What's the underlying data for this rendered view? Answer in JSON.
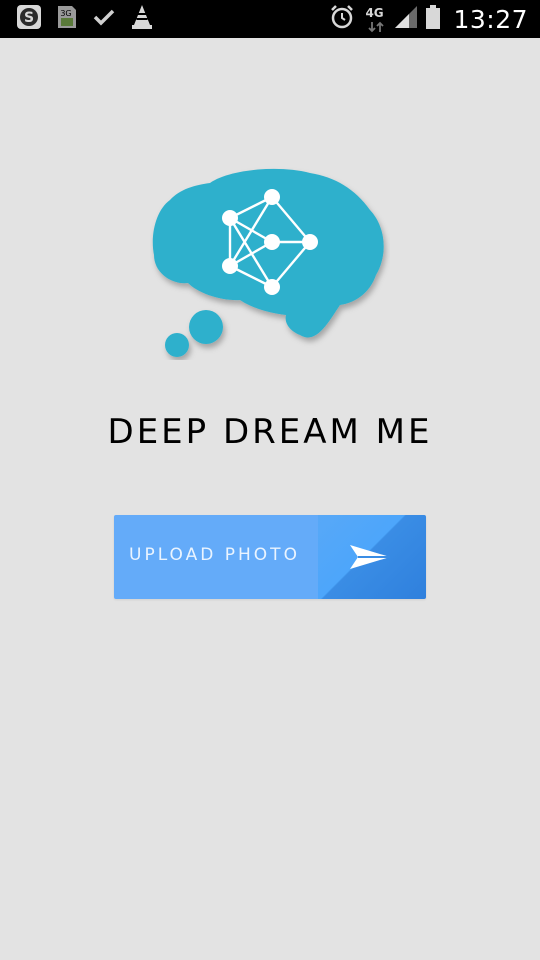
{
  "status_bar": {
    "time": "13:27",
    "network_label": "4G",
    "left_icons": [
      "skype-icon",
      "3g-sim-icon",
      "checkmark-icon",
      "vlc-icon"
    ],
    "right_icons": [
      "alarm-icon",
      "4g-data-icon",
      "signal-icon",
      "battery-icon"
    ]
  },
  "app": {
    "title": "DEEP DREAM ME",
    "logo": "brain-network-logo",
    "brand_color": "#2fb0cc"
  },
  "upload": {
    "label": "UPLOAD PHOTO",
    "icon": "send-icon",
    "color_left": "#64abf9",
    "color_right": "#3a8de5"
  }
}
